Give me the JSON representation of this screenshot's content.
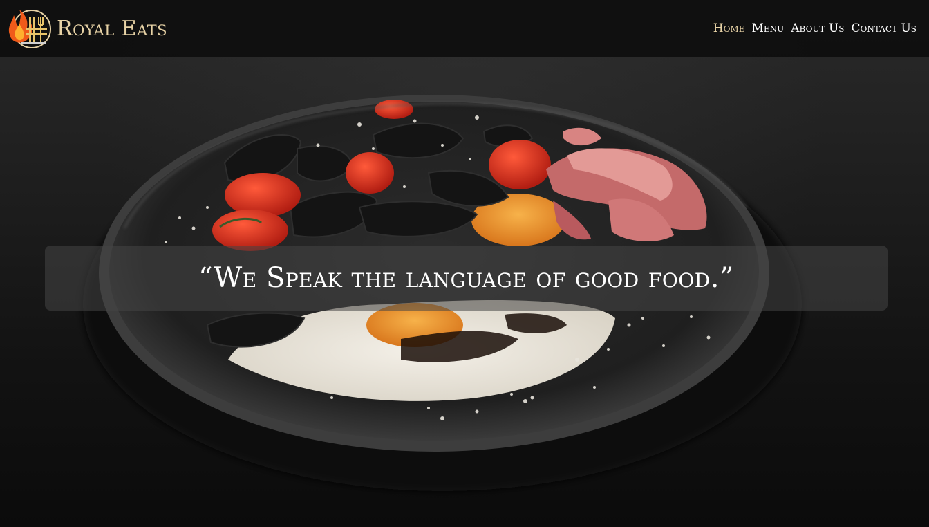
{
  "brand": {
    "name": "Royal Eats",
    "logo_icon": "flame-fork-knife-logo-icon"
  },
  "nav": {
    "items": [
      {
        "label": "Home",
        "active": true
      },
      {
        "label": "Menu",
        "active": false
      },
      {
        "label": "About Us",
        "active": false
      },
      {
        "label": "Contact Us",
        "active": false
      }
    ]
  },
  "hero": {
    "tagline": "“We Speak the language of good food.”",
    "image_icon": "plated-dish-photo"
  },
  "colors": {
    "accent": "#e8d3a6",
    "nav_text": "#ffffff",
    "navbar_bg": "#0c0c0c",
    "flame": "#f05a1a"
  }
}
